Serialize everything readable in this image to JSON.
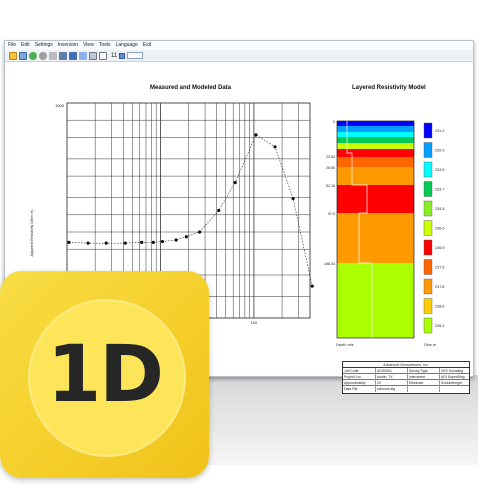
{
  "menubar": {
    "items": [
      "File",
      "Edit",
      "Settings",
      "Inversion",
      "View",
      "Tools",
      "Language",
      "Exit"
    ]
  },
  "toolbar": {
    "icons": [
      "open-icon",
      "save-icon",
      "run-icon",
      "stop-icon",
      "pause-icon",
      "forward-icon",
      "disk-icon",
      "copy-icon",
      "print-icon",
      "page-icon"
    ],
    "layer_count": "11"
  },
  "colors": {
    "icon_yellow": "#f5cf2b",
    "icon_circle": "#fde55a",
    "layer_palette": [
      "#0000ff",
      "#00a0ff",
      "#00ffff",
      "#00cc55",
      "#88ee22",
      "#ccff00",
      "#ff0000",
      "#ff6600",
      "#ff9900",
      "#ffcc00",
      "#aaff00"
    ]
  },
  "chart_data": [
    {
      "type": "scatter",
      "title": "Measured and Modeled Data",
      "y_tick_top": "1000",
      "x_tick_label": "100",
      "xscale": "log",
      "yscale": "log",
      "grid": true,
      "points_x_rel": [
        1,
        1.6,
        2.5,
        4,
        6,
        8,
        10,
        14,
        18,
        25,
        40,
        60,
        100,
        160,
        250,
        400
      ],
      "points_y": [
        245,
        244,
        244,
        244,
        245,
        245,
        246,
        248,
        252,
        258,
        285,
        320,
        380,
        365,
        300,
        190
      ]
    },
    {
      "type": "table",
      "title": "Layered Resistivity Model",
      "depth_labels": [
        "0",
        "23.54",
        "26.65",
        "52.16",
        "97.0",
        "166.54"
      ],
      "xlabel_left": "Depth: m/s",
      "xlabel_right": "Ohm.m",
      "legend_values": [
        "231.2",
        "232.9",
        "233.5",
        "233.7",
        "234.5",
        "236.0",
        "236.9",
        "237.5",
        "237.8",
        "238.6",
        "239.4"
      ]
    }
  ],
  "info_table": {
    "header": "Advanced Geosciences, Inc.",
    "rows": [
      [
        "Job Code",
        "ADG0001",
        "Survey Type",
        "VES Sounding"
      ],
      [
        "Project Loc.",
        "Austin, TX",
        "Instrument",
        "AGI SuperSting"
      ],
      [
        "Approximately",
        "20",
        "Electrode",
        "Schlumberger"
      ],
      [
        "Data File",
        "schlumb.stg",
        "",
        ""
      ]
    ]
  },
  "app_icon": {
    "label": "1D"
  }
}
